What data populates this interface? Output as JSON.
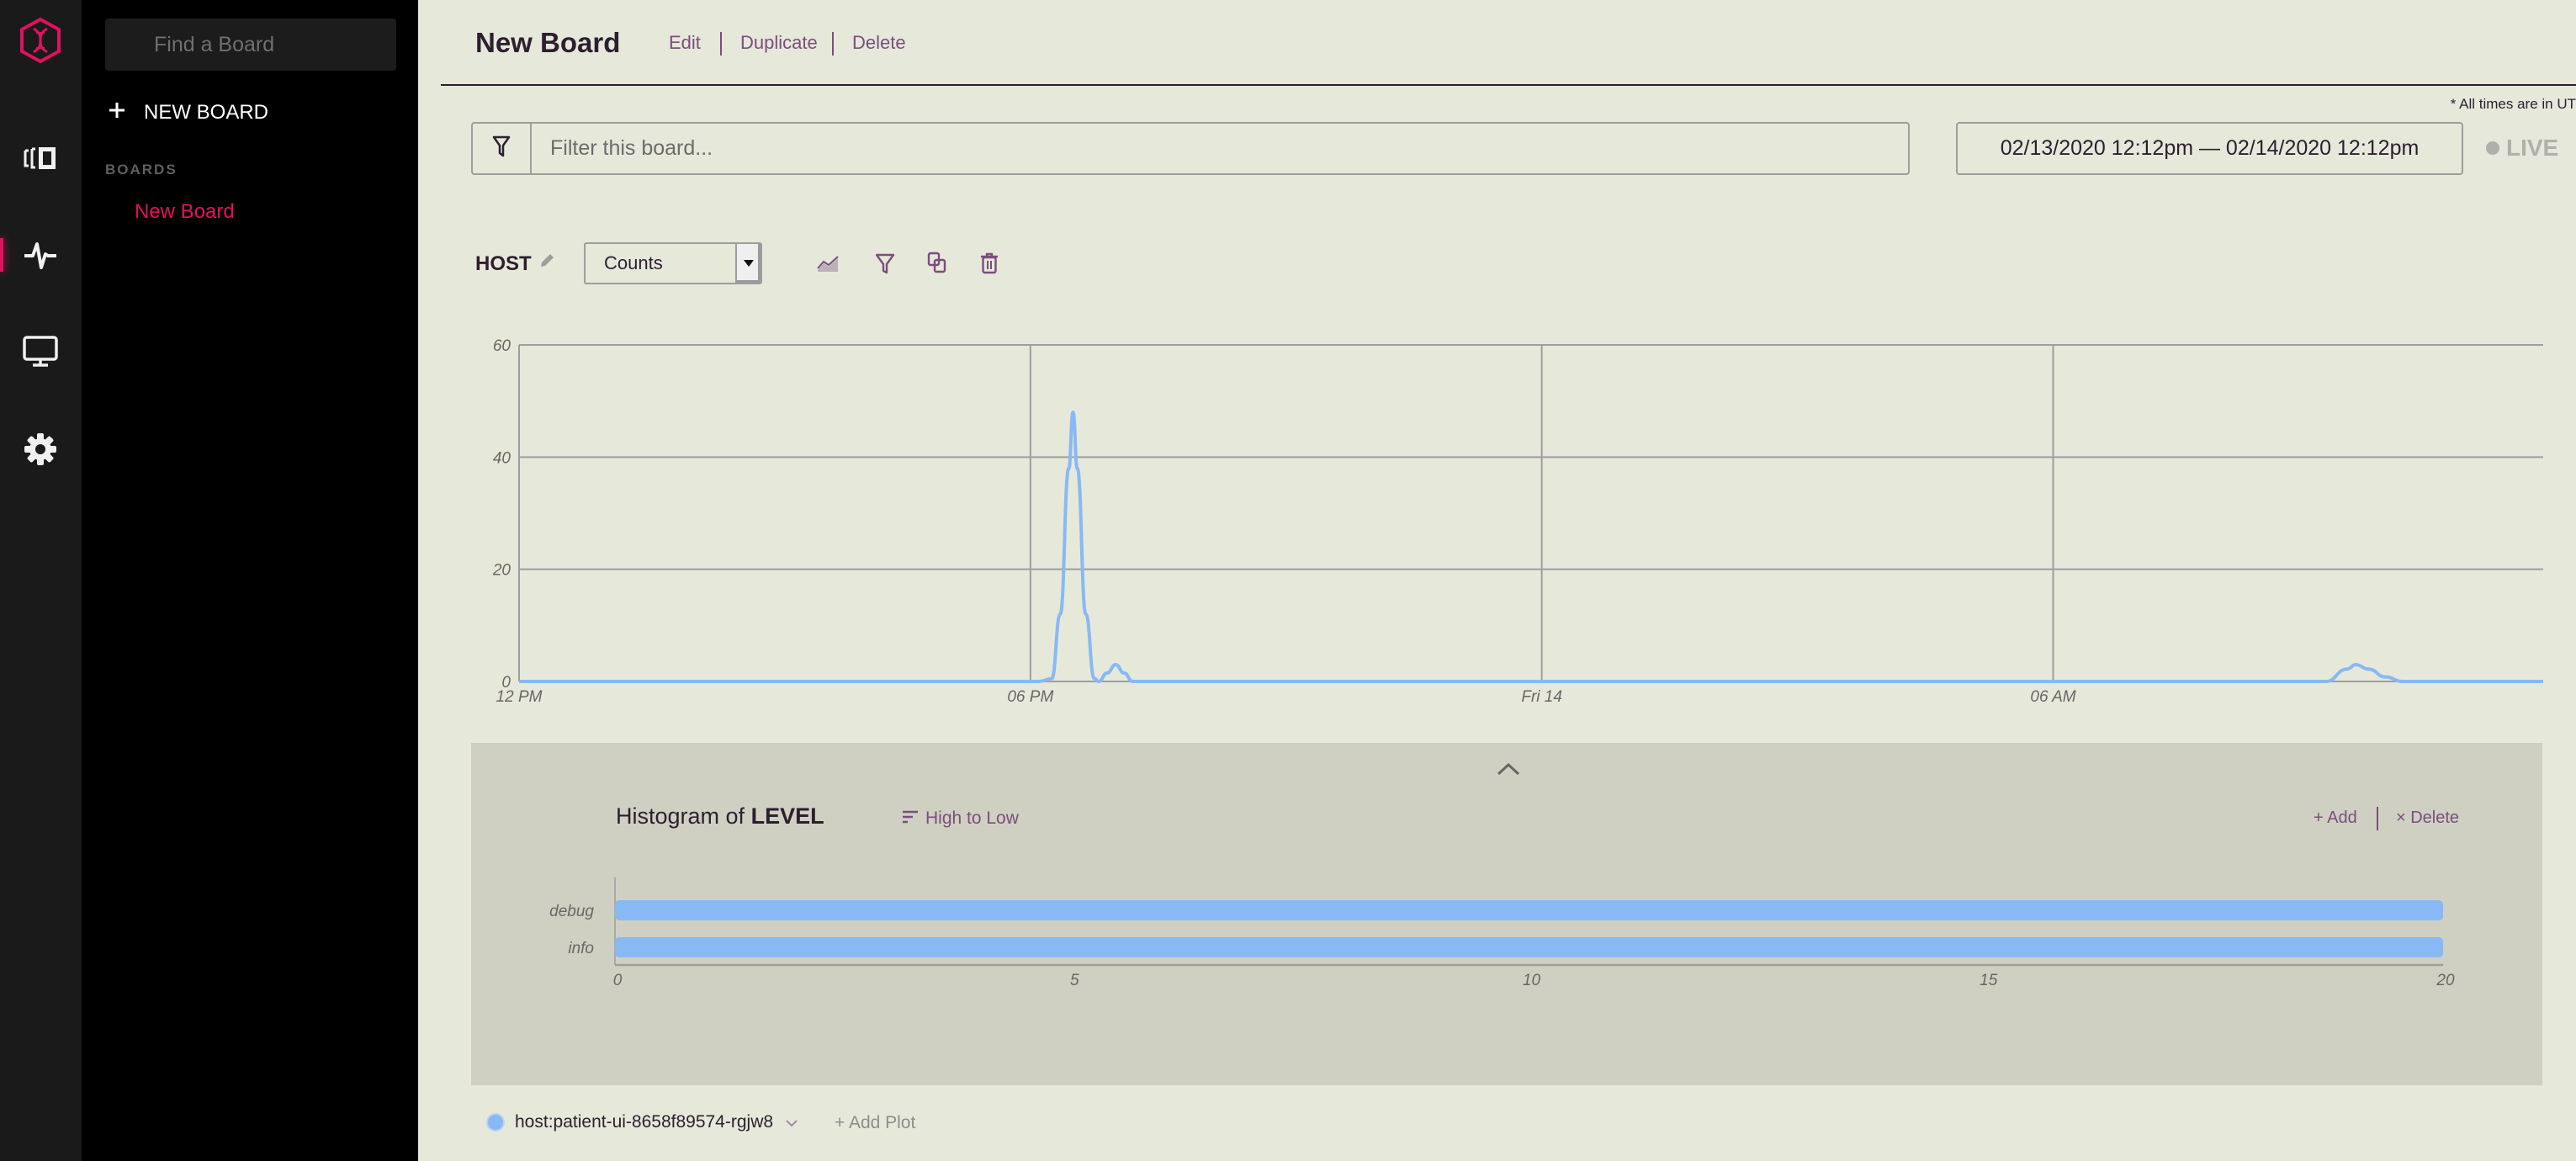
{
  "app": {
    "accent_color": "#e0115f",
    "link_color": "#7b4e7c",
    "series_color": "#88b9f4"
  },
  "rail": {
    "items": [
      {
        "icon": "logo-icon"
      },
      {
        "icon": "live-tail-icon"
      },
      {
        "icon": "boards-icon",
        "active": true
      },
      {
        "icon": "monitor-icon"
      },
      {
        "icon": "settings-icon"
      }
    ]
  },
  "sidebar": {
    "search_placeholder": "Find a Board",
    "new_board_label": "NEW BOARD",
    "section_label": "BOARDS",
    "boards": [
      {
        "label": "New Board",
        "active": true
      }
    ]
  },
  "header": {
    "title": "New Board",
    "actions": [
      "Edit",
      "Duplicate",
      "Delete"
    ],
    "timezone_note": "* All times are in UT"
  },
  "filter": {
    "placeholder": "Filter this board...",
    "value": ""
  },
  "date_range": {
    "label": "02/13/2020 12:12pm — 02/14/2020 12:12pm"
  },
  "live": {
    "label": "LIVE"
  },
  "plot": {
    "field_label": "HOST",
    "aggregation": "Counts",
    "tools": [
      "chart-type-icon",
      "filter-icon",
      "duplicate-icon",
      "trash-icon"
    ]
  },
  "chart_data": [
    {
      "type": "line",
      "title": "HOST",
      "xlabel": "",
      "ylabel": "Counts",
      "x_ticks": [
        "12 PM",
        "06 PM",
        "Fri 14",
        "06 AM"
      ],
      "x_hours_from_noon": [
        0,
        6,
        12,
        18
      ],
      "xlim_hours_from_noon": [
        0,
        23.75
      ],
      "ylim": [
        0,
        60
      ],
      "y_ticks": [
        0,
        20,
        40,
        60
      ],
      "grid": true,
      "series": [
        {
          "name": "host:patient-ui-8658f89574-rgjw8",
          "color": "#88b9f4",
          "points": [
            [
              0,
              0
            ],
            [
              6.1,
              0
            ],
            [
              6.25,
              0.5
            ],
            [
              6.35,
              12
            ],
            [
              6.45,
              38
            ],
            [
              6.5,
              48
            ],
            [
              6.55,
              38
            ],
            [
              6.65,
              12
            ],
            [
              6.75,
              0.5
            ],
            [
              6.8,
              0
            ],
            [
              6.9,
              1.5
            ],
            [
              7.0,
              3
            ],
            [
              7.1,
              1.5
            ],
            [
              7.2,
              0
            ],
            [
              21.2,
              0
            ],
            [
              21.45,
              2.2
            ],
            [
              21.55,
              3
            ],
            [
              21.7,
              2.2
            ],
            [
              21.9,
              0.8
            ],
            [
              22.1,
              0
            ],
            [
              23.75,
              0
            ]
          ]
        }
      ]
    },
    {
      "type": "bar",
      "orientation": "horizontal",
      "title": "Histogram of LEVEL",
      "title_prefix": "Histogram of",
      "title_field": "LEVEL",
      "categories": [
        "debug",
        "info"
      ],
      "values": [
        20,
        20
      ],
      "xlim": [
        0,
        20
      ],
      "x_ticks": [
        0,
        5,
        10,
        15,
        20
      ],
      "color": "#88b9f4"
    }
  ],
  "histogram": {
    "sort_label": "High to Low",
    "add_label": "+ Add",
    "delete_label": "× Delete"
  },
  "legend": {
    "items": [
      {
        "label": "host:patient-ui-8658f89574-rgjw8",
        "color": "#88b9f4"
      }
    ],
    "add_plot_label": "+ Add Plot"
  }
}
